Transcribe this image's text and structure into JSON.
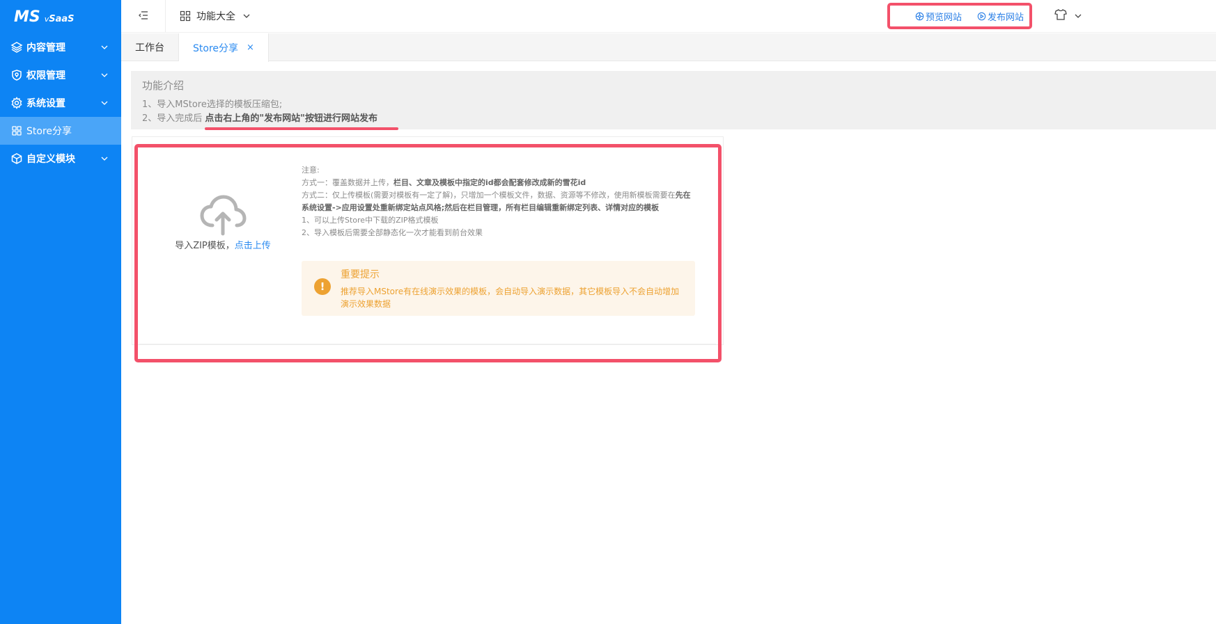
{
  "brand": {
    "logo_ms": "MS",
    "logo_v": "v",
    "logo_saas": "SaaS"
  },
  "sidebar": {
    "items": [
      {
        "label": "内容管理",
        "icon": "layers-icon",
        "has_children": true
      },
      {
        "label": "权限管理",
        "icon": "shield-icon",
        "has_children": true
      },
      {
        "label": "系统设置",
        "icon": "gear-icon",
        "has_children": true
      },
      {
        "label": "Store分享",
        "icon": "grid-icon",
        "has_children": false,
        "active": true
      },
      {
        "label": "自定义模块",
        "icon": "cube-icon",
        "has_children": true
      }
    ]
  },
  "topbar": {
    "menu_label": "功能大全",
    "preview_label": "预览网站",
    "publish_label": "发布网站"
  },
  "tabs": [
    {
      "label": "工作台",
      "active": false
    },
    {
      "label": "Store分享",
      "active": true,
      "close": "×"
    }
  ],
  "intro": {
    "title": "功能介绍",
    "line1": "1、导入MStore选择的模板压缩包;",
    "line2_prefix": "2、导入完成后 ",
    "line2_strong": "点击右上角的\"发布网站\"按钮进行网站发布"
  },
  "upload": {
    "text": "导入ZIP模板，",
    "link": "点击上传"
  },
  "notes": {
    "title": "注意:",
    "mode1_prefix": "方式一：覆盖数据并上传，",
    "mode1_strong": "栏目、文章及模板中指定的id都会配套修改成新的雪花id",
    "mode2_prefix": "方式二：仅上传模板(需要对模板有一定了解)，只增加一个模板文件，数据、资源等不修改，使用新模板需要在",
    "mode2_strong": "先在系统设置->应用设置处重新绑定站点风格;然后在栏目管理，所有栏目编辑重新绑定列表、详情对应的模板",
    "item1": "1、可以上传Store中下载的ZIP格式模板",
    "item2": "2、导入模板后需要全部静态化一次才能看到前台效果"
  },
  "alert": {
    "title": "重要提示",
    "body": "推荐导入MStore有在线演示效果的模板，会自动导入演示数据，其它模板导入不会自动增加演示效果数据",
    "icon": "!"
  },
  "colors": {
    "sidebar": "#0d84f4",
    "sidebar_active": "#4aa5f8",
    "link": "#2a8af0",
    "highlight": "#f3516a",
    "warning": "#eda232"
  }
}
